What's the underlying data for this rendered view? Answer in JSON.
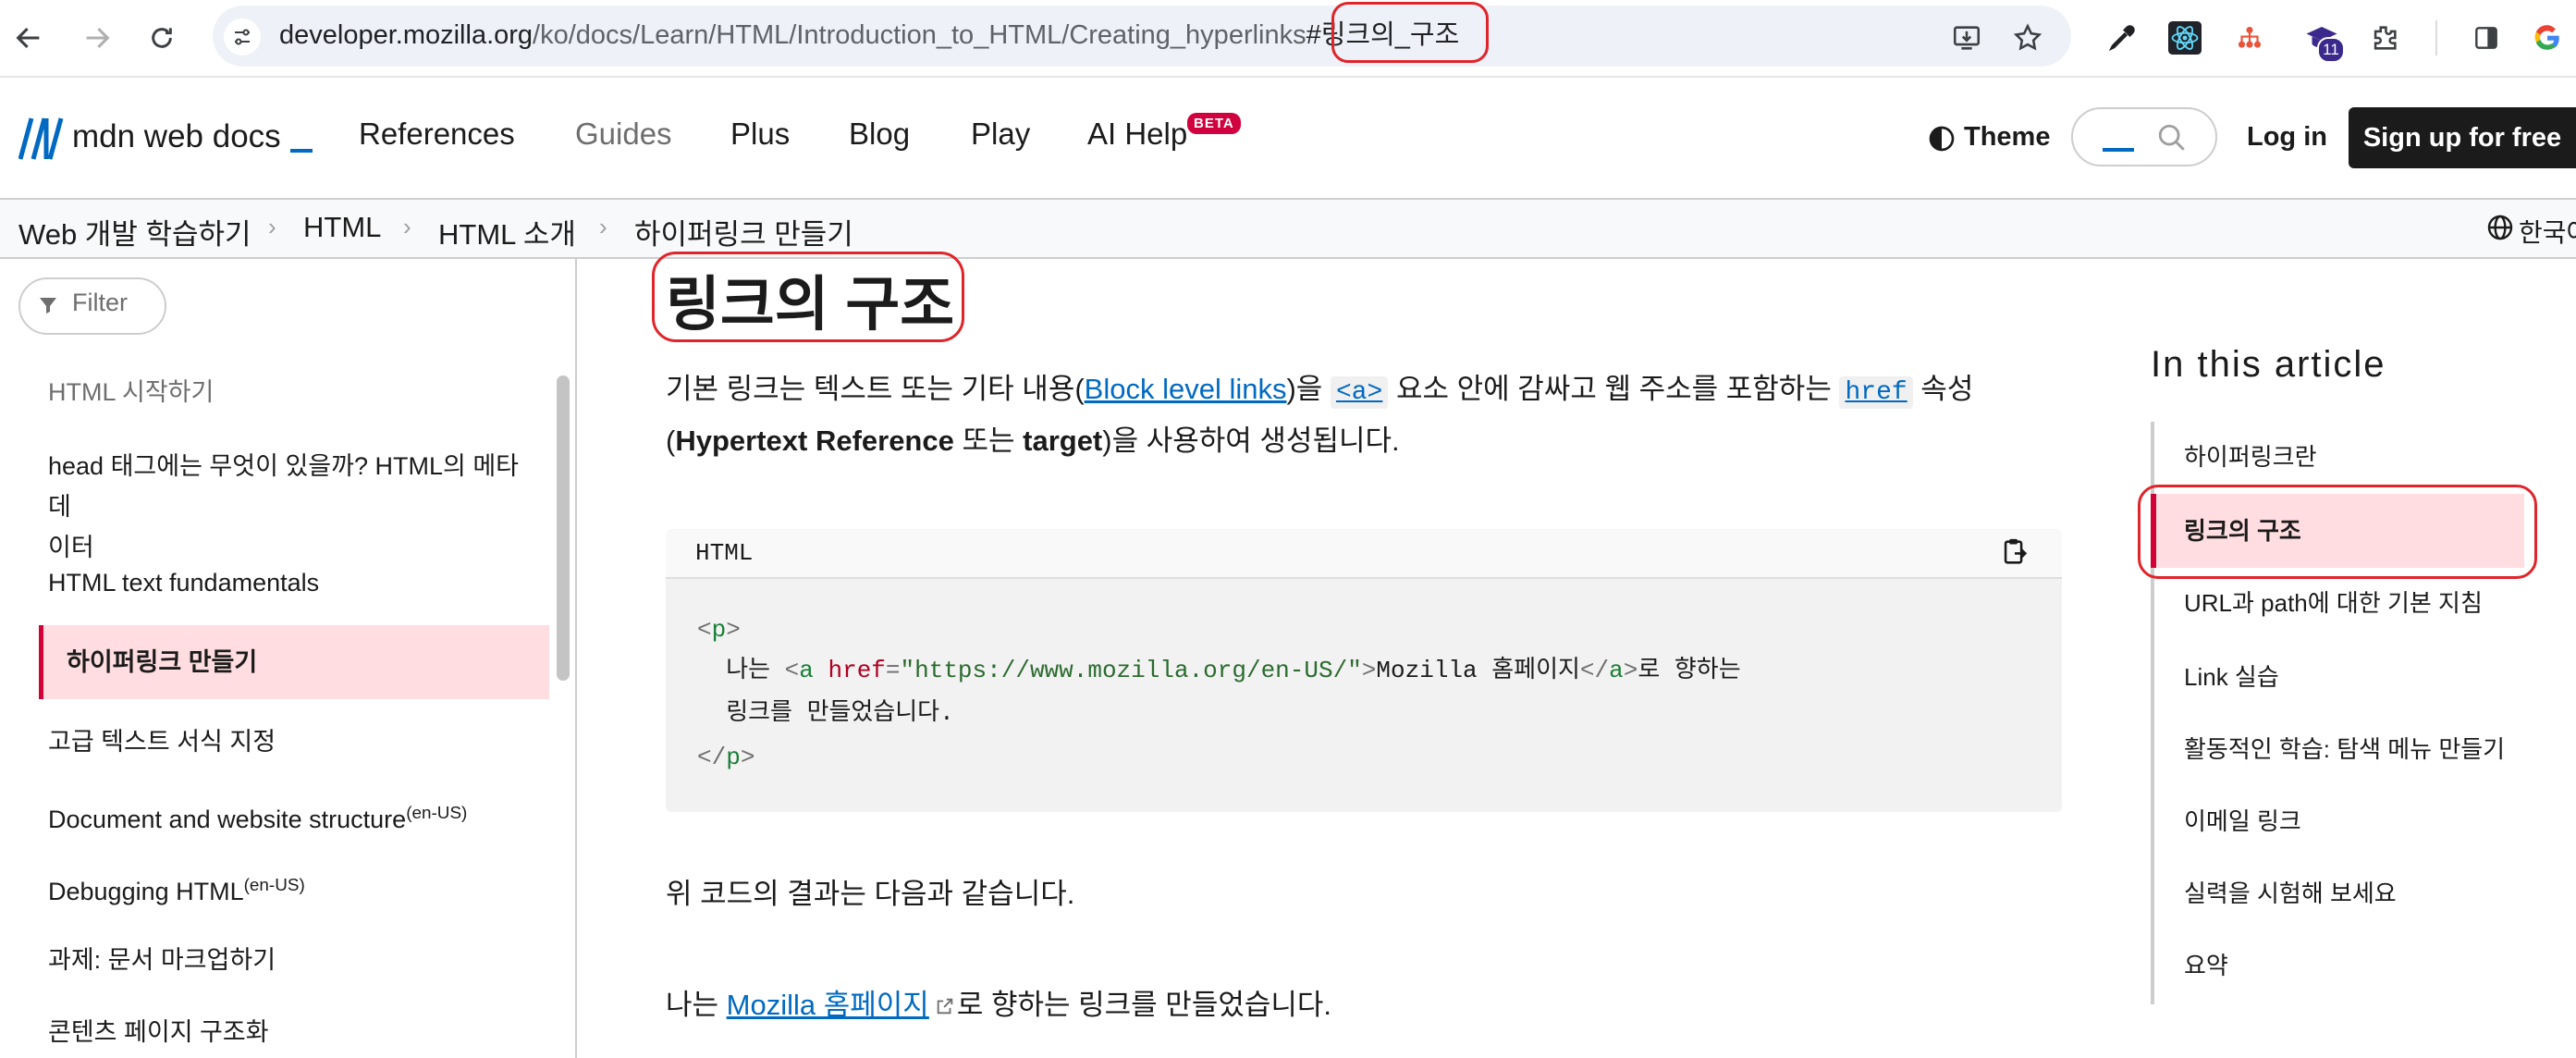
{
  "browser": {
    "url_host": "developer.mozilla.org",
    "url_path": "/ko/docs/Learn/HTML/Introduction_to_HTML/Creating_hyperlinks",
    "url_hash": "#링크의_구조",
    "extension_badge": "11"
  },
  "header": {
    "logo_text": "mdn web docs",
    "nav": [
      "References",
      "Guides",
      "Plus",
      "Blog",
      "Play",
      "AI Help"
    ],
    "beta_badge": "BETA",
    "theme_label": "Theme",
    "login_label": "Log in",
    "signup_label": "Sign up for free"
  },
  "breadcrumb": {
    "items": [
      "Web 개발 학습하기",
      "HTML",
      "HTML 소개",
      "하이퍼링크 만들기"
    ],
    "language": "한국어"
  },
  "sidebar": {
    "filter_label": "Filter",
    "items": [
      {
        "label": "HTML 시작하기"
      },
      {
        "label": "head 태그에는 무엇이 있을까? HTML의 메타데",
        "label2": "이터"
      },
      {
        "label": "HTML text fundamentals"
      },
      {
        "label": "하이퍼링크 만들기"
      },
      {
        "label": "고급 텍스트 서식 지정"
      },
      {
        "label": "Document and website structure",
        "sup": "(en-US)"
      },
      {
        "label": "Debugging HTML",
        "sup": "(en-US)"
      },
      {
        "label": "과제: 문서 마크업하기"
      },
      {
        "label": "콘텐츠 페이지 구조화"
      }
    ]
  },
  "main": {
    "title": "링크의 구조",
    "para1": {
      "t1": "기본 링크는 텍스트 또는 기타 내용(",
      "link": "Block level links",
      "t2": ")을 ",
      "code1": "<a>",
      "t3": " 요소 안에 감싸고 웹 주소를 포함하는 ",
      "code2": "href",
      "t4": " 속성",
      "line2_a": "(",
      "bold1": "Hypertext Reference",
      "line2_b": " 또는 ",
      "bold2": "target",
      "line2_c": ")을 사용하여 생성됩니다."
    },
    "code": {
      "lang": "HTML",
      "line1_tag": "p",
      "line2_prefix": "  나는 ",
      "line2_tag": "a",
      "line2_attr": "href",
      "line2_value": "\"https://www.mozilla.org/en-US/\"",
      "line2_text": "Mozilla 홈페이지",
      "line2_suffix": "로 향하는",
      "line3": "  링크를 만들었습니다."
    },
    "result_text": "위 코드의 결과는 다음과 같습니다.",
    "result_prefix": "나는 ",
    "result_link": "Mozilla 홈페이지",
    "result_suffix": "로 향하는 링크를 만들었습니다."
  },
  "toc": {
    "title": "In this article",
    "items": [
      "하이퍼링크란",
      "링크의 구조",
      "URL과 path에 대한 기본 지침",
      "Link 실습",
      "활동적인 학습: 탐색 메뉴 만들기",
      "이메일 링크",
      "실력을 시험해 보세요",
      "요약"
    ]
  },
  "colors": {
    "accent_red": "#d30038",
    "highlight_pink": "#ffdde0",
    "link_blue": "#0069c2",
    "annotation_red": "#e0242a"
  }
}
